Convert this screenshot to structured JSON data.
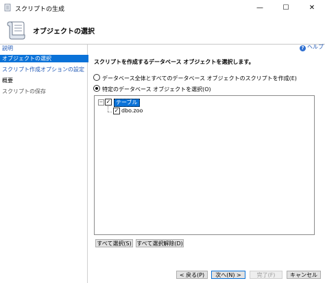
{
  "window": {
    "title": "スクリプトの生成",
    "minimize": "—",
    "maximize": "☐",
    "close": "✕"
  },
  "header": {
    "title": "オブジェクトの選択",
    "icon": "scroll-script-icon"
  },
  "sidebar": {
    "items": [
      {
        "label": "説明",
        "state": "link"
      },
      {
        "label": "オブジェクトの選択",
        "state": "selected"
      },
      {
        "label": "スクリプト作成オプションの設定",
        "state": "link"
      },
      {
        "label": "概要",
        "state": "normal"
      },
      {
        "label": "スクリプトの保存",
        "state": "disabled"
      }
    ]
  },
  "help": {
    "label": "ヘルプ",
    "icon": "help-icon"
  },
  "main": {
    "instruction": "スクリプトを作成するデータベース オブジェクトを選択します。",
    "radio_all": "データベース全体とすべてのデータベース オブジェクトのスクリプトを作成(E)",
    "radio_specific": "特定のデータベース オブジェクトを選択(O)",
    "selected_option": "specific",
    "tree": {
      "root_label": "テーブル",
      "root_checked": true,
      "children": [
        {
          "label": "dbo.zoo",
          "checked": true
        }
      ]
    },
    "select_all": "すべて選択(S)",
    "deselect_all": "すべて選択解除(D)"
  },
  "footer": {
    "back": "< 戻る(P)",
    "next": "次へ(N) >",
    "finish": "完了(F)",
    "cancel": "キャンセル"
  },
  "colors": {
    "selection": "#0a72d8",
    "link": "#1f57b5"
  }
}
